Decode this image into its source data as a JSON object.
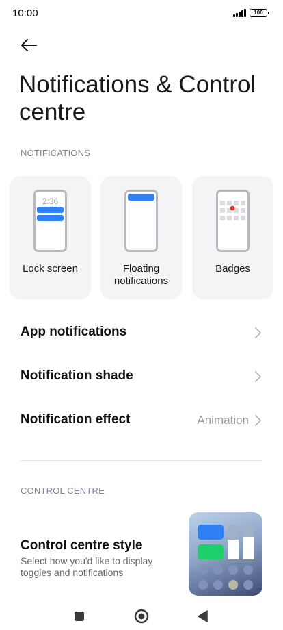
{
  "status": {
    "time": "10:00",
    "battery": "100"
  },
  "header": {
    "title": "Notifications & Control centre"
  },
  "notifications": {
    "section_label": "NOTIFICATIONS",
    "lock_time": "2:36",
    "cards": [
      {
        "label": "Lock screen"
      },
      {
        "label": "Floating notifications"
      },
      {
        "label": "Badges"
      }
    ]
  },
  "rows": [
    {
      "title": "App notifications",
      "value": ""
    },
    {
      "title": "Notification shade",
      "value": ""
    },
    {
      "title": "Notification effect",
      "value": "Animation"
    }
  ],
  "control_centre": {
    "section_label": "CONTROL CENTRE",
    "style_title": "Control centre style",
    "style_subtitle": "Select how you'd like to display toggles and notifications"
  },
  "colors": {
    "accent_blue": "#2f80f5",
    "badge_red": "#e3342f",
    "tile_green": "#1fcf69"
  },
  "icons": {
    "back": "arrow-left-icon",
    "chevron": "chevron-right-icon",
    "nav_recents": "square-icon",
    "nav_home": "circle-icon",
    "nav_back": "triangle-left-icon"
  }
}
